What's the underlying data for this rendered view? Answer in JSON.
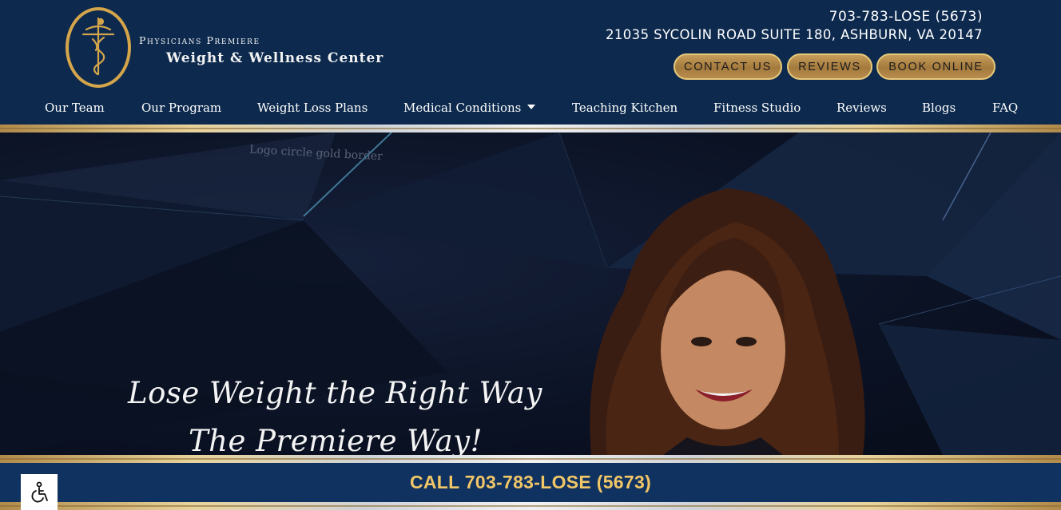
{
  "brand": {
    "line1": "Physicians Premiere",
    "line2": "Weight & Wellness Center"
  },
  "contact": {
    "phone": "703-783-LOSE (5673)",
    "address": "21035 SYCOLIN ROAD SUITE 180, ASHBURN, VA 20147"
  },
  "buttons": {
    "contact": "CONTACT US",
    "reviews": "REVIEWS",
    "book": "BOOK ONLINE"
  },
  "nav": {
    "items": [
      "Our Team",
      "Our Program",
      "Weight Loss Plans",
      "Medical Conditions",
      "Teaching Kitchen",
      "Fitness Studio",
      "Reviews",
      "Blogs",
      "FAQ"
    ]
  },
  "hero": {
    "image_alt": "Logo circle gold border",
    "tagline_line1": "Lose Weight the Right Way",
    "tagline_line2": "The Premiere Way!"
  },
  "call_band": {
    "text": "CALL 703-783-LOSE (5673)"
  },
  "icons": {
    "logo": "caduceus-figure-icon",
    "nav_dropdown": "caret-down-icon",
    "accessibility": "wheelchair-icon"
  },
  "colors": {
    "header_bg": "#0d2a4e",
    "gold": "#d4a54a",
    "call_text": "#f1c667",
    "call_band_bg": "#103260"
  }
}
